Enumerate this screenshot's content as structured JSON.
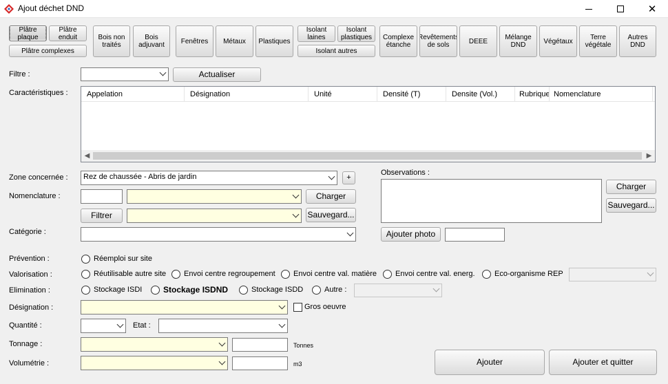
{
  "window": {
    "title": "Ajout déchet DND"
  },
  "categories": {
    "platre_plaque": "Plâtre plaque",
    "platre_enduit": "Plâtre enduit",
    "platre_complexes": "Plâtre complexes",
    "bois_non_traites": "Bois non traités",
    "bois_adjuvant": "Bois adjuvant",
    "fenetres": "Fenêtres",
    "metaux": "Métaux",
    "plastiques": "Plastiques",
    "isolant_laines": "Isolant laines",
    "isolant_plastiques": "Isolant plastiques",
    "isolant_autres": "Isolant autres",
    "complexe_etanche": "Complexe étanche",
    "revetements_sols": "Revêtements de sols",
    "deee": "DEEE",
    "melange_dnd": "Mélange DND",
    "vegetaux": "Végétaux",
    "terre_vegetale": "Terre végétale",
    "autres_dnd": "Autres DND"
  },
  "filter": {
    "label": "Filtre :",
    "value": "",
    "refresh_button": "Actualiser"
  },
  "characteristics": {
    "label": "Caractéristiques :",
    "columns": [
      "Appelation",
      "Désignation",
      "Unité",
      "Densité (T)",
      "Densite (Vol.)",
      "Rubrique",
      "Nomenclature"
    ]
  },
  "zone": {
    "label": "Zone concernée :",
    "value": "Rez de chaussée - Abris de jardin",
    "add_button": "+"
  },
  "nomenclature": {
    "label": "Nomenclature :",
    "code": "",
    "value": "",
    "load_button": "Charger",
    "save_button": "Sauvegard..."
  },
  "filter_row": {
    "filter_button": "Filtrer",
    "value": "",
    "save_button": "Sauvegard..."
  },
  "category": {
    "label": "Catégorie :",
    "value": ""
  },
  "observations": {
    "label": "Observations :",
    "value": "",
    "load_button": "Charger",
    "save_button": "Sauvegard...",
    "add_photo_button": "Ajouter photo",
    "photo_value": ""
  },
  "prevention": {
    "label": "Prévention :",
    "options": [
      "Réemploi sur site"
    ]
  },
  "valorisation": {
    "label": "Valorisation :",
    "options": [
      "Réutilisable autre site",
      "Envoi centre regroupement",
      "Envoi centre val. matière",
      "Envoi centre val. energ.",
      "Eco-organisme REP"
    ],
    "rep_value": ""
  },
  "elimination": {
    "label": "Elimination :",
    "options": [
      "Stockage ISDI",
      "Stockage ISDND",
      "Stockage ISDD",
      "Autre :"
    ],
    "autre_value": ""
  },
  "designation": {
    "label": "Désignation :",
    "value": "",
    "gros_oeuvre": "Gros oeuvre"
  },
  "quantity": {
    "label": "Quantité :",
    "value": "",
    "etat_label": "Etat :",
    "etat_value": ""
  },
  "tonnage": {
    "label": "Tonnage :",
    "value": "",
    "amount": "",
    "unit": "Tonnes"
  },
  "volumetrie": {
    "label": "Volumétrie :",
    "value": "",
    "amount": "",
    "unit": "m3"
  },
  "actions": {
    "add": "Ajouter",
    "add_quit": "Ajouter et quitter"
  },
  "colors": {
    "optional_field_bg": "#ffffe1",
    "window_bg": "#f0f0f0"
  }
}
